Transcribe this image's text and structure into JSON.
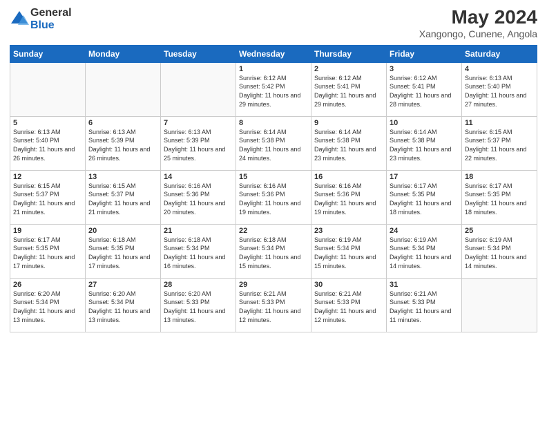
{
  "header": {
    "logo_general": "General",
    "logo_blue": "Blue",
    "main_title": "May 2024",
    "subtitle": "Xangongo, Cunene, Angola"
  },
  "weekdays": [
    "Sunday",
    "Monday",
    "Tuesday",
    "Wednesday",
    "Thursday",
    "Friday",
    "Saturday"
  ],
  "weeks": [
    [
      {
        "day": "",
        "sunrise": "",
        "sunset": "",
        "daylight": ""
      },
      {
        "day": "",
        "sunrise": "",
        "sunset": "",
        "daylight": ""
      },
      {
        "day": "",
        "sunrise": "",
        "sunset": "",
        "daylight": ""
      },
      {
        "day": "1",
        "sunrise": "6:12 AM",
        "sunset": "5:42 PM",
        "daylight": "11 hours and 29 minutes."
      },
      {
        "day": "2",
        "sunrise": "6:12 AM",
        "sunset": "5:41 PM",
        "daylight": "11 hours and 29 minutes."
      },
      {
        "day": "3",
        "sunrise": "6:12 AM",
        "sunset": "5:41 PM",
        "daylight": "11 hours and 28 minutes."
      },
      {
        "day": "4",
        "sunrise": "6:13 AM",
        "sunset": "5:40 PM",
        "daylight": "11 hours and 27 minutes."
      }
    ],
    [
      {
        "day": "5",
        "sunrise": "6:13 AM",
        "sunset": "5:40 PM",
        "daylight": "11 hours and 26 minutes."
      },
      {
        "day": "6",
        "sunrise": "6:13 AM",
        "sunset": "5:39 PM",
        "daylight": "11 hours and 26 minutes."
      },
      {
        "day": "7",
        "sunrise": "6:13 AM",
        "sunset": "5:39 PM",
        "daylight": "11 hours and 25 minutes."
      },
      {
        "day": "8",
        "sunrise": "6:14 AM",
        "sunset": "5:38 PM",
        "daylight": "11 hours and 24 minutes."
      },
      {
        "day": "9",
        "sunrise": "6:14 AM",
        "sunset": "5:38 PM",
        "daylight": "11 hours and 23 minutes."
      },
      {
        "day": "10",
        "sunrise": "6:14 AM",
        "sunset": "5:38 PM",
        "daylight": "11 hours and 23 minutes."
      },
      {
        "day": "11",
        "sunrise": "6:15 AM",
        "sunset": "5:37 PM",
        "daylight": "11 hours and 22 minutes."
      }
    ],
    [
      {
        "day": "12",
        "sunrise": "6:15 AM",
        "sunset": "5:37 PM",
        "daylight": "11 hours and 21 minutes."
      },
      {
        "day": "13",
        "sunrise": "6:15 AM",
        "sunset": "5:37 PM",
        "daylight": "11 hours and 21 minutes."
      },
      {
        "day": "14",
        "sunrise": "6:16 AM",
        "sunset": "5:36 PM",
        "daylight": "11 hours and 20 minutes."
      },
      {
        "day": "15",
        "sunrise": "6:16 AM",
        "sunset": "5:36 PM",
        "daylight": "11 hours and 19 minutes."
      },
      {
        "day": "16",
        "sunrise": "6:16 AM",
        "sunset": "5:36 PM",
        "daylight": "11 hours and 19 minutes."
      },
      {
        "day": "17",
        "sunrise": "6:17 AM",
        "sunset": "5:35 PM",
        "daylight": "11 hours and 18 minutes."
      },
      {
        "day": "18",
        "sunrise": "6:17 AM",
        "sunset": "5:35 PM",
        "daylight": "11 hours and 18 minutes."
      }
    ],
    [
      {
        "day": "19",
        "sunrise": "6:17 AM",
        "sunset": "5:35 PM",
        "daylight": "11 hours and 17 minutes."
      },
      {
        "day": "20",
        "sunrise": "6:18 AM",
        "sunset": "5:35 PM",
        "daylight": "11 hours and 17 minutes."
      },
      {
        "day": "21",
        "sunrise": "6:18 AM",
        "sunset": "5:34 PM",
        "daylight": "11 hours and 16 minutes."
      },
      {
        "day": "22",
        "sunrise": "6:18 AM",
        "sunset": "5:34 PM",
        "daylight": "11 hours and 15 minutes."
      },
      {
        "day": "23",
        "sunrise": "6:19 AM",
        "sunset": "5:34 PM",
        "daylight": "11 hours and 15 minutes."
      },
      {
        "day": "24",
        "sunrise": "6:19 AM",
        "sunset": "5:34 PM",
        "daylight": "11 hours and 14 minutes."
      },
      {
        "day": "25",
        "sunrise": "6:19 AM",
        "sunset": "5:34 PM",
        "daylight": "11 hours and 14 minutes."
      }
    ],
    [
      {
        "day": "26",
        "sunrise": "6:20 AM",
        "sunset": "5:34 PM",
        "daylight": "11 hours and 13 minutes."
      },
      {
        "day": "27",
        "sunrise": "6:20 AM",
        "sunset": "5:34 PM",
        "daylight": "11 hours and 13 minutes."
      },
      {
        "day": "28",
        "sunrise": "6:20 AM",
        "sunset": "5:33 PM",
        "daylight": "11 hours and 13 minutes."
      },
      {
        "day": "29",
        "sunrise": "6:21 AM",
        "sunset": "5:33 PM",
        "daylight": "11 hours and 12 minutes."
      },
      {
        "day": "30",
        "sunrise": "6:21 AM",
        "sunset": "5:33 PM",
        "daylight": "11 hours and 12 minutes."
      },
      {
        "day": "31",
        "sunrise": "6:21 AM",
        "sunset": "5:33 PM",
        "daylight": "11 hours and 11 minutes."
      },
      {
        "day": "",
        "sunrise": "",
        "sunset": "",
        "daylight": ""
      }
    ]
  ]
}
